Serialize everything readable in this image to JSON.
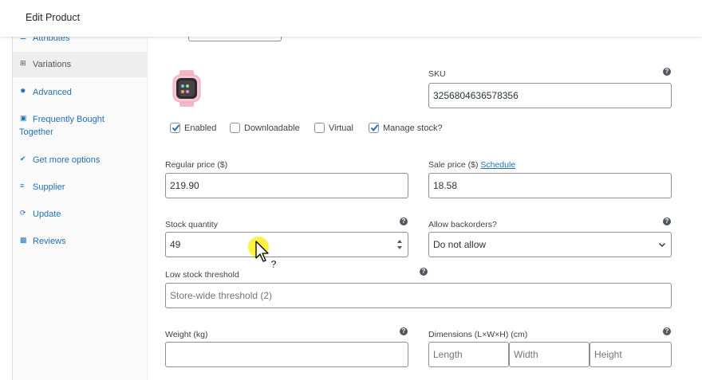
{
  "header": {
    "title": "Edit Product"
  },
  "sidebar": {
    "items": [
      {
        "label": "Attributes",
        "icon": "list-icon"
      },
      {
        "label": "Variations",
        "icon": "grid-icon",
        "active": true
      },
      {
        "label": "Advanced",
        "icon": "gear-icon"
      },
      {
        "label": "Frequently Bought",
        "label2": "Together",
        "icon": "bag-icon"
      },
      {
        "label": "Get more options",
        "icon": "plugin-icon"
      },
      {
        "label": "Supplier",
        "icon": "cart-icon"
      },
      {
        "label": "Update",
        "icon": "refresh-icon"
      },
      {
        "label": "Reviews",
        "icon": "megaphone-icon"
      }
    ]
  },
  "variation": {
    "sku": {
      "label": "SKU",
      "value": "3256804636578356"
    },
    "checkboxes": [
      {
        "label": "Enabled",
        "checked": true
      },
      {
        "label": "Downloadable",
        "checked": false
      },
      {
        "label": "Virtual",
        "checked": false
      },
      {
        "label": "Manage stock?",
        "checked": true
      }
    ],
    "regular_price": {
      "label": "Regular price ($)",
      "value": "219.90"
    },
    "sale_price": {
      "label": "Sale price ($)",
      "link": "Schedule",
      "value": "18.58"
    },
    "stock_quantity": {
      "label": "Stock quantity",
      "value": "49"
    },
    "backorders": {
      "label": "Allow backorders?",
      "value": "Do not allow"
    },
    "low_stock": {
      "label": "Low stock threshold",
      "placeholder": "Store-wide threshold (2)"
    },
    "weight": {
      "label": "Weight (kg)",
      "value": ""
    },
    "dimensions": {
      "label": "Dimensions (L×W×H) (cm)",
      "length": "Length",
      "width": "Width",
      "height": "Height"
    }
  },
  "colors": {
    "link": "#2271b1",
    "border": "#8c8f94",
    "check": "#2271b1",
    "highlight": "#ffec00"
  }
}
